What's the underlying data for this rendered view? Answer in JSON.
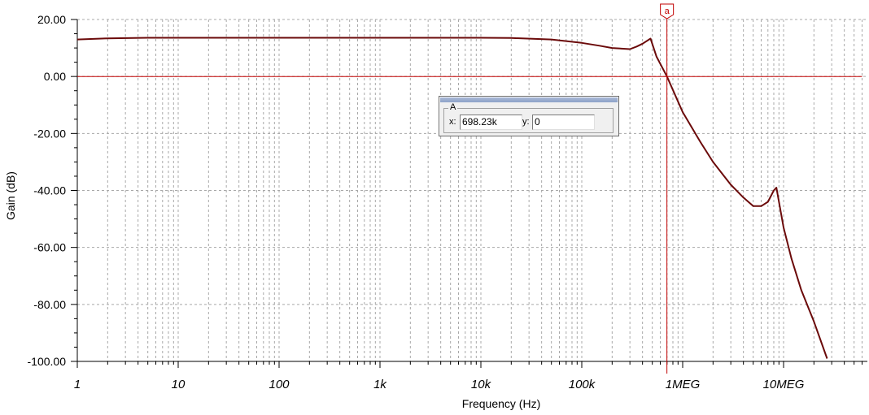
{
  "chart_data": {
    "type": "line",
    "title": "",
    "xlabel": "Frequency (Hz)",
    "ylabel": "Gain (dB)",
    "xscale": "log",
    "xlim": [
      1,
      60000000
    ],
    "ylim": [
      -100,
      20
    ],
    "grid": true,
    "legend": "none",
    "x_ticks": [
      {
        "value": 1,
        "label": "1"
      },
      {
        "value": 10,
        "label": "10"
      },
      {
        "value": 100,
        "label": "100"
      },
      {
        "value": 1000,
        "label": "1k"
      },
      {
        "value": 10000,
        "label": "10k"
      },
      {
        "value": 100000,
        "label": "100k"
      },
      {
        "value": 1000000,
        "label": "1MEG"
      },
      {
        "value": 10000000,
        "label": "10MEG"
      }
    ],
    "y_ticks": [
      {
        "value": 20,
        "label": "20.00"
      },
      {
        "value": 0,
        "label": "0.00"
      },
      {
        "value": -20,
        "label": "-20.00"
      },
      {
        "value": -40,
        "label": "-40.00"
      },
      {
        "value": -60,
        "label": "-60.00"
      },
      {
        "value": -80,
        "label": "-80.00"
      },
      {
        "value": -100,
        "label": "-100.00"
      }
    ],
    "series": [
      {
        "color": "#6b0a0a",
        "x": [
          1,
          2,
          5,
          10,
          100,
          1000,
          10000,
          20000,
          50000,
          100000,
          150000,
          200000,
          300000,
          350000,
          400000,
          480000,
          550000,
          698230,
          1000000,
          1500000,
          2000000,
          3000000,
          4000000,
          5000000,
          6000000,
          7000000,
          8000000,
          8500000,
          10000000,
          12000000,
          15000000,
          20000000,
          27000000
        ],
        "y": [
          13,
          13.4,
          13.6,
          13.6,
          13.6,
          13.6,
          13.6,
          13.5,
          13,
          11.8,
          10.8,
          10,
          9.6,
          10.5,
          11.5,
          13.3,
          7,
          0,
          -12.5,
          -23,
          -30,
          -38,
          -42.5,
          -45.5,
          -45.5,
          -44,
          -40,
          -39,
          -53,
          -64,
          -75,
          -86,
          -99
        ]
      },
      {
        "color": "#c00000",
        "x": [
          1,
          60000000
        ],
        "y": [
          0,
          0
        ]
      }
    ],
    "cursor": {
      "label": "a",
      "x": 698230,
      "color": "#c00000"
    }
  },
  "readout": {
    "group_title": "A",
    "x_label": "x:",
    "x_value": "698.23k",
    "y_label": "y:",
    "y_value": "0"
  }
}
